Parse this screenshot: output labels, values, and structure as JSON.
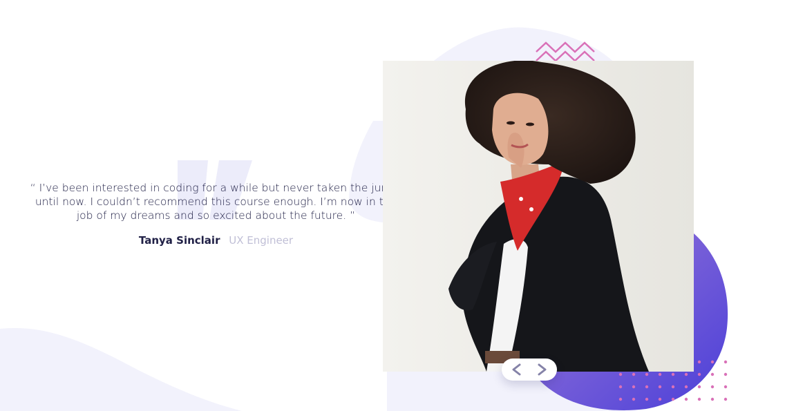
{
  "testimonial": {
    "quote": "“ I’ve been interested in coding for a while but never taken the jump, until now. I couldn’t recommend this course enough. I’m now in the job of my dreams and so excited about the future. ”",
    "author_name": "Tanya Sinclair",
    "author_role": "UX Engineer"
  },
  "slider": {
    "prev_icon": "chevron-left-icon",
    "next_icon": "chevron-right-icon"
  },
  "colors": {
    "dark_navy": "#202046",
    "muted_lavender": "#c0bfd6",
    "purple_gradient_start": "#8c6bd6",
    "purple_gradient_end": "#4b3fd8",
    "pink_accent": "#d971b8",
    "soft_lavender_bg": "#f1f1fb",
    "chevron": "#8583a8"
  }
}
